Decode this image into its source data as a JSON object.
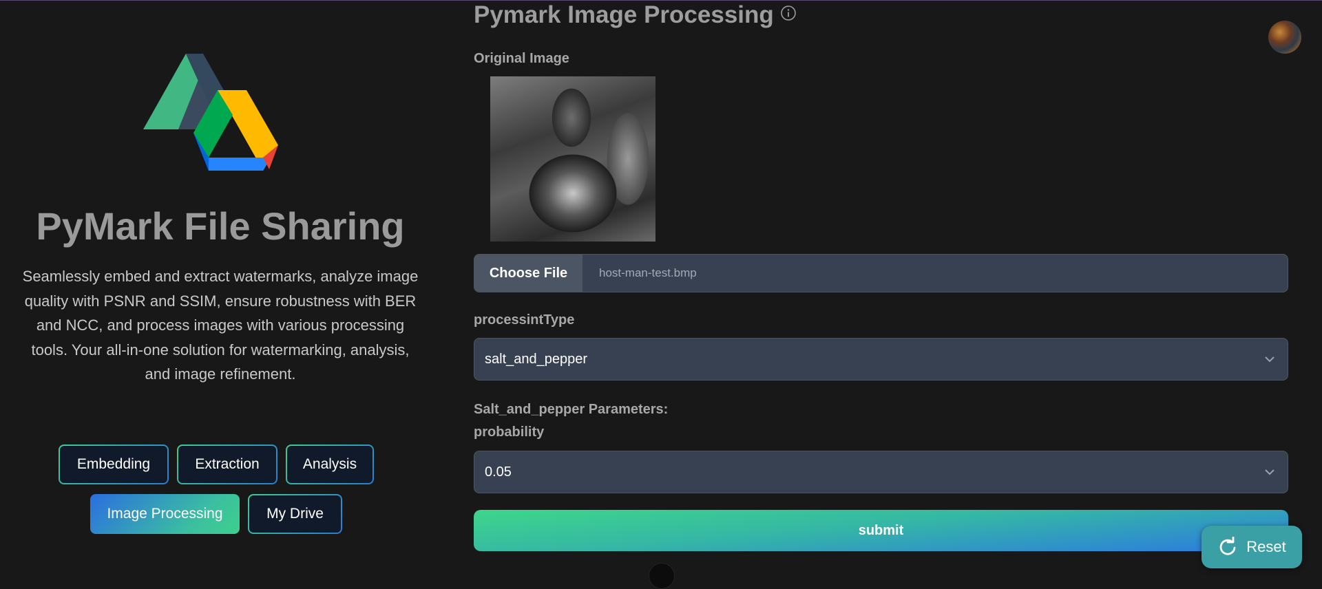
{
  "sidebar": {
    "title": "PyMark File Sharing",
    "description": "Seamlessly embed and extract watermarks, analyze image quality with PSNR and SSIM, ensure robustness with BER and NCC, and process images with various processing tools. Your all-in-one solution for watermarking, analysis, and image refinement.",
    "nav": [
      {
        "label": "Embedding"
      },
      {
        "label": "Extraction"
      },
      {
        "label": "Analysis"
      },
      {
        "label": "Image Processing",
        "active": true
      },
      {
        "label": "My Drive"
      }
    ]
  },
  "main": {
    "title": "Pymark Image Processing",
    "original_image_label": "Original Image",
    "file": {
      "button_label": "Choose File",
      "file_name": "host-man-test.bmp"
    },
    "processing_type": {
      "label": "processintType",
      "value": "salt_and_pepper"
    },
    "parameters_heading": "Salt_and_pepper Parameters:",
    "probability": {
      "label": "probability",
      "value": "0.05"
    },
    "submit_label": "submit"
  },
  "floating": {
    "reset_label": "Reset"
  },
  "icons": {
    "logo": "pymark-drive-logo",
    "info": "info-icon",
    "chevron": "chevron-down-icon",
    "reset": "refresh-icon"
  },
  "colors": {
    "background": "#181818",
    "accent_green": "#3ecf8e",
    "accent_blue": "#2a7bd8",
    "input_bg": "#374151"
  }
}
